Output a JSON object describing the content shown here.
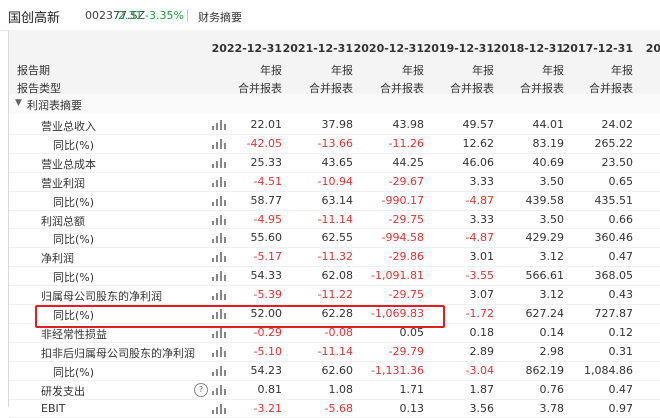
{
  "header": {
    "company": "国创高新",
    "code": "002377.SZ",
    "price": "2.31",
    "change": "-3.35%",
    "tab": "财务摘要"
  },
  "columns": [
    {
      "date": "2022-12-31",
      "period": "年报",
      "type": "合并报表"
    },
    {
      "date": "2021-12-31",
      "period": "年报",
      "type": "合并报表"
    },
    {
      "date": "2020-12-31",
      "period": "年报",
      "type": "合并报表"
    },
    {
      "date": "2019-12-31",
      "period": "年报",
      "type": "合并报表"
    },
    {
      "date": "2018-12-31",
      "period": "年报",
      "type": "合并报表"
    },
    {
      "date": "2017-12-31",
      "period": "年报",
      "type": "合并报表"
    },
    {
      "date": "20",
      "period": "",
      "type": ""
    }
  ],
  "labels": {
    "report_period": "报告期",
    "report_type": "报告类型",
    "section": "利润表摘要"
  },
  "rows": [
    {
      "label": "营业总收入",
      "indent": 1,
      "values": [
        "22.01",
        "37.98",
        "43.98",
        "49.57",
        "44.01",
        "24.02"
      ]
    },
    {
      "label": "同比(%)",
      "indent": 2,
      "values": [
        "-42.05",
        "-13.66",
        "-11.26",
        "12.62",
        "83.19",
        "265.22"
      ]
    },
    {
      "label": "营业总成本",
      "indent": 1,
      "values": [
        "25.33",
        "43.65",
        "44.25",
        "46.06",
        "40.69",
        "23.50"
      ]
    },
    {
      "label": "营业利润",
      "indent": 1,
      "values": [
        "-4.51",
        "-10.94",
        "-29.67",
        "3.33",
        "3.50",
        "0.65"
      ]
    },
    {
      "label": "同比(%)",
      "indent": 2,
      "values": [
        "58.77",
        "63.14",
        "-990.17",
        "-4.87",
        "439.58",
        "435.51"
      ]
    },
    {
      "label": "利润总额",
      "indent": 1,
      "values": [
        "-4.95",
        "-11.14",
        "-29.75",
        "3.33",
        "3.50",
        "0.66"
      ]
    },
    {
      "label": "同比(%)",
      "indent": 2,
      "values": [
        "55.60",
        "62.55",
        "-994.58",
        "-4.87",
        "429.29",
        "360.46"
      ]
    },
    {
      "label": "净利润",
      "indent": 1,
      "values": [
        "-5.17",
        "-11.32",
        "-29.86",
        "3.01",
        "3.12",
        "0.47"
      ]
    },
    {
      "label": "同比(%)",
      "indent": 2,
      "values": [
        "54.33",
        "62.08",
        "-1,091.81",
        "-3.55",
        "566.61",
        "368.05"
      ]
    },
    {
      "label": "归属母公司股东的净利润",
      "indent": 1,
      "values": [
        "-5.39",
        "-11.22",
        "-29.75",
        "3.07",
        "3.12",
        "0.43"
      ]
    },
    {
      "label": "同比(%)",
      "indent": 2,
      "values": [
        "52.00",
        "62.28",
        "-1,069.83",
        "-1.72",
        "627.24",
        "727.87"
      ]
    },
    {
      "label": "非经常性损益",
      "indent": 1,
      "values": [
        "-0.29",
        "-0.08",
        "0.05",
        "0.18",
        "0.14",
        "0.12"
      ]
    },
    {
      "label": "扣非后归属母公司股东的净利润",
      "indent": 1,
      "values": [
        "-5.10",
        "-11.14",
        "-29.79",
        "2.89",
        "2.98",
        "0.31"
      ]
    },
    {
      "label": "同比(%)",
      "indent": 2,
      "values": [
        "54.23",
        "62.60",
        "-1,131.36",
        "-3.04",
        "862.19",
        "1,084.86"
      ]
    },
    {
      "label": "研发支出",
      "indent": 1,
      "help": true,
      "values": [
        "0.81",
        "1.08",
        "1.71",
        "1.87",
        "0.76",
        "0.47"
      ]
    },
    {
      "label": "EBIT",
      "indent": 1,
      "values": [
        "-3.21",
        "-5.68",
        "0.13",
        "3.56",
        "3.78",
        "0.97"
      ]
    }
  ],
  "colors": {
    "negative": "#e53333",
    "highlight": "#e02020",
    "price_up": "#1a9c3a"
  }
}
